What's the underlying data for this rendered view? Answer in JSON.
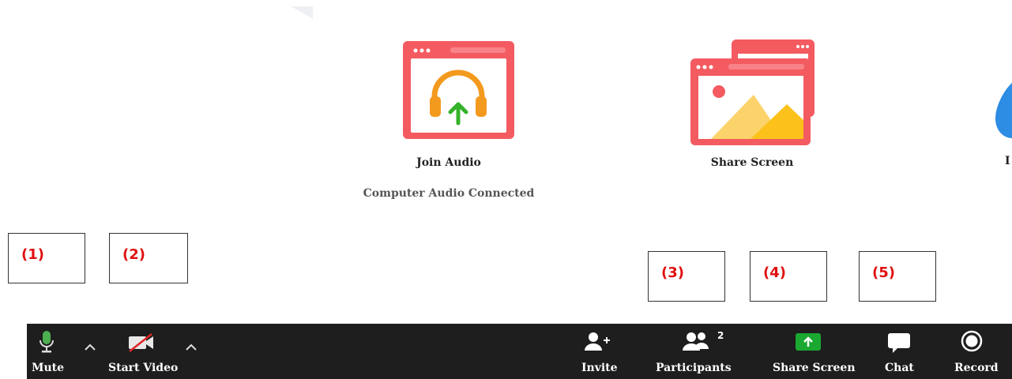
{
  "tiles": {
    "join_audio": {
      "label": "Join Audio",
      "sub": "Computer Audio Connected"
    },
    "share_screen": {
      "label": "Share Screen"
    },
    "partial_label": "I"
  },
  "annotations": [
    "(1)",
    "(2)",
    "(3)",
    "(4)",
    "(5)"
  ],
  "toolbar": {
    "mute": "Mute",
    "start_video": "Start Video",
    "invite": "Invite",
    "participants": "Participants",
    "participants_count": "2",
    "share_screen": "Share Screen",
    "chat": "Chat",
    "record": "Record"
  },
  "colors": {
    "tile_red": "#f35b60",
    "toolbar_bg": "#1e1e1e",
    "mic_green": "#4caf50",
    "share_green": "#1aa830",
    "annotation_red": "#e01010"
  }
}
